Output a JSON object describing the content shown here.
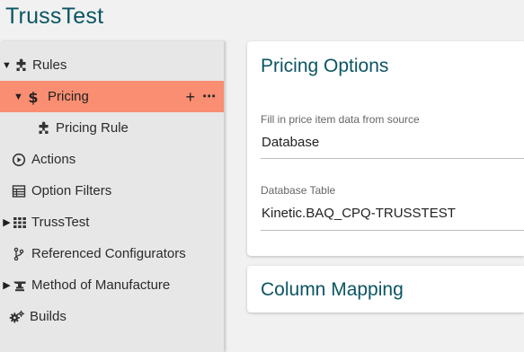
{
  "app": {
    "title": "TrussTest"
  },
  "tree": {
    "rules": {
      "label": "Rules",
      "icon": "puzzle-icon"
    },
    "pricing": {
      "label": "Pricing",
      "icon": "dollar-icon",
      "add_label": "+",
      "more_label": "⋯"
    },
    "pricing_rule": {
      "label": "Pricing Rule",
      "icon": "puzzle-icon"
    },
    "actions": {
      "label": "Actions",
      "icon": "play-circle-icon"
    },
    "option_filters": {
      "label": "Option Filters",
      "icon": "table-icon"
    },
    "trusstest": {
      "label": "TrussTest",
      "icon": "grid-icon"
    },
    "referenced_configurators": {
      "label": "Referenced Configurators",
      "icon": "branch-icon"
    },
    "method_of_manufacture": {
      "label": "Method of Manufacture",
      "icon": "anvil-icon"
    },
    "builds": {
      "label": "Builds",
      "icon": "gears-icon"
    }
  },
  "pricing_options": {
    "title": "Pricing Options",
    "source_label": "Fill in price item data from source",
    "source_value": "Database",
    "table_label": "Database Table",
    "table_value": "Kinetic.BAQ_CPQ-TRUSSTEST"
  },
  "column_mapping": {
    "title": "Column Mapping"
  },
  "colors": {
    "accent": "#0b5563",
    "selected": "#f98e72",
    "sidebar": "#e7e7e7"
  }
}
